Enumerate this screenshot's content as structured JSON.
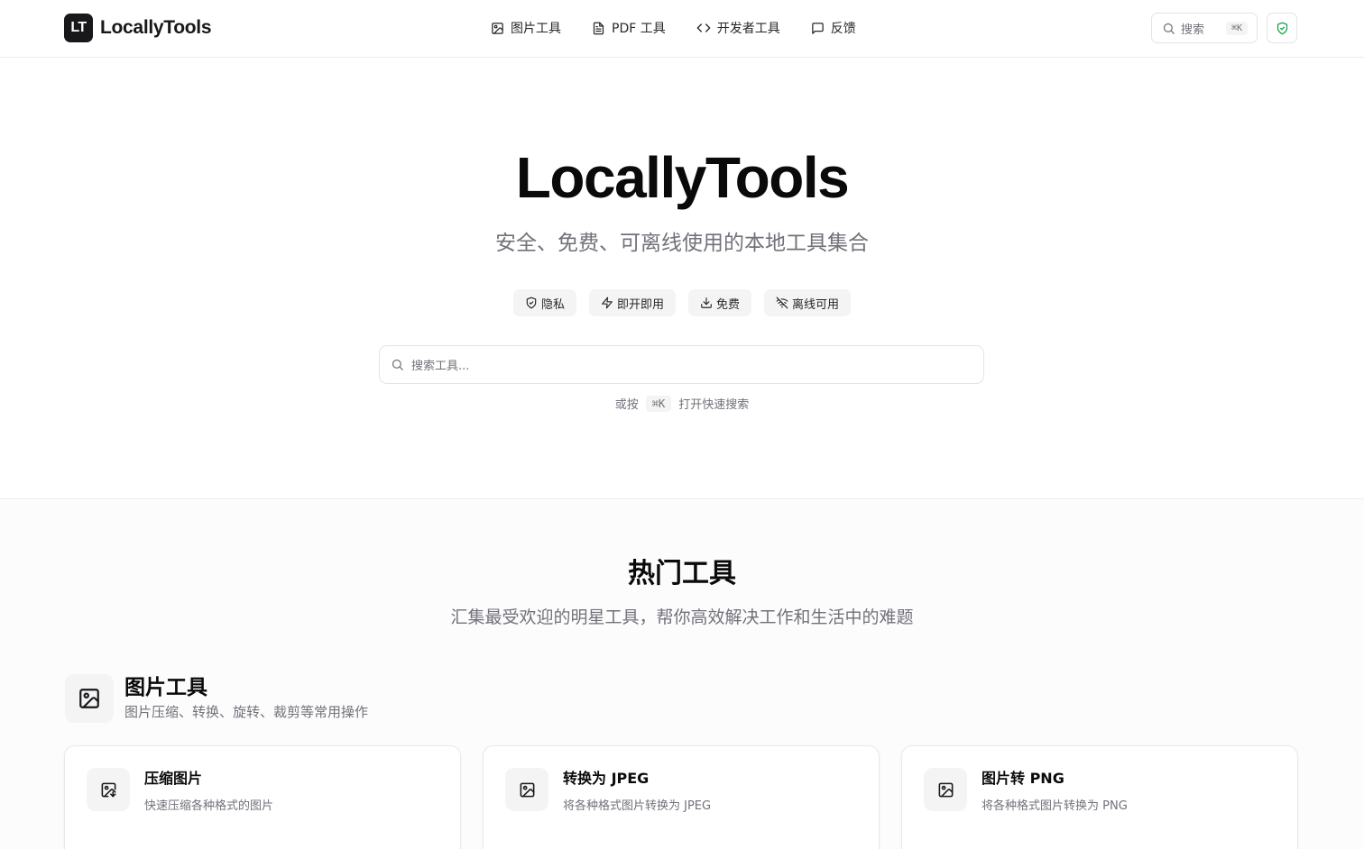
{
  "header": {
    "logo_mark": "LT",
    "logo_text": "LocallyTools",
    "nav": [
      {
        "label": "图片工具",
        "icon": "image-icon"
      },
      {
        "label": "PDF 工具",
        "icon": "file-text-icon"
      },
      {
        "label": "开发者工具",
        "icon": "code-icon"
      },
      {
        "label": "反馈",
        "icon": "message-square-icon"
      }
    ],
    "search_label": "搜索",
    "search_shortcut": "⌘K",
    "shield_icon": "shield-check-icon",
    "shield_color": "#16a34a"
  },
  "hero": {
    "title": "LocallyTools",
    "subtitle": "安全、免费、可离线使用的本地工具集合",
    "badges": [
      {
        "label": "隐私",
        "icon": "shield-icon"
      },
      {
        "label": "即开即用",
        "icon": "zap-icon"
      },
      {
        "label": "免费",
        "icon": "download-icon"
      },
      {
        "label": "离线可用",
        "icon": "wifi-off-icon"
      }
    ],
    "search_placeholder": "搜索工具...",
    "hint_prefix": "或按",
    "hint_kbd": "⌘K",
    "hint_suffix": "打开快速搜索"
  },
  "popular": {
    "title": "热门工具",
    "subtitle": "汇集最受欢迎的明星工具，帮你高效解决工作和生活中的难题",
    "category": {
      "title": "图片工具",
      "subtitle": "图片压缩、转换、旋转、裁剪等常用操作",
      "icon": "image-icon"
    },
    "cards": [
      {
        "title": "压缩图片",
        "desc": "快速压缩各种格式的图片",
        "icon": "image-compress-icon"
      },
      {
        "title": "转换为 JPEG",
        "desc": "将各种格式图片转换为 JPEG",
        "icon": "image-icon"
      },
      {
        "title": "图片转 PNG",
        "desc": "将各种格式图片转换为 PNG",
        "icon": "image-icon"
      }
    ]
  }
}
